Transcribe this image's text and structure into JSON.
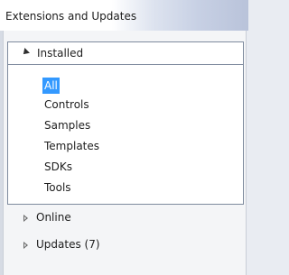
{
  "window": {
    "title": "Extensions and Updates"
  },
  "tree": {
    "installed": {
      "label": "Installed",
      "items": [
        "All",
        "Controls",
        "Samples",
        "Templates",
        "SDKs",
        "Tools"
      ],
      "selected": "All"
    },
    "online": {
      "label": "Online"
    },
    "updates": {
      "label": "Updates (7)"
    }
  },
  "colors": {
    "selection": "#3399ff",
    "border": "#7e8a9d"
  }
}
